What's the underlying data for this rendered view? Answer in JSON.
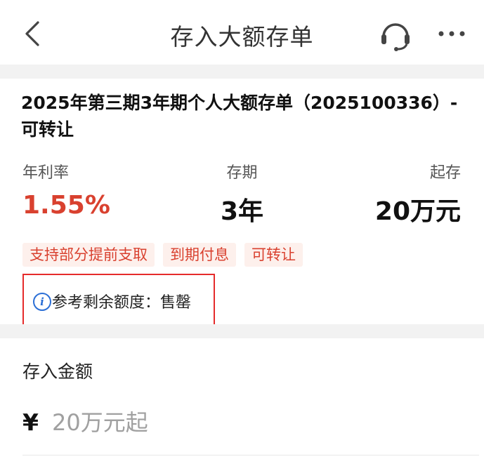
{
  "header": {
    "title": "存入大额存单",
    "icons": [
      "back-chevron-icon",
      "headset-icon",
      "more-dots-icon"
    ]
  },
  "product": {
    "title": "2025年第三期3年期个人大额存单（2025100336）-可转让",
    "rate_label": "年利率",
    "rate_value": "1.55%",
    "term_label": "存期",
    "term_value": "3年",
    "min_label": "起存",
    "min_value": "20万元",
    "tags": [
      "支持部分提前支取",
      "到期付息",
      "可转让"
    ],
    "quota_text": "参考剩余额度：售罄"
  },
  "deposit": {
    "label": "存入金额",
    "currency": "¥",
    "placeholder": "20万元起"
  },
  "colors": {
    "rate_red": "#d9412f",
    "tag_bg": "#fdf0ec",
    "highlight_box": "#e52b2b",
    "info_blue": "#2b6fd6"
  }
}
